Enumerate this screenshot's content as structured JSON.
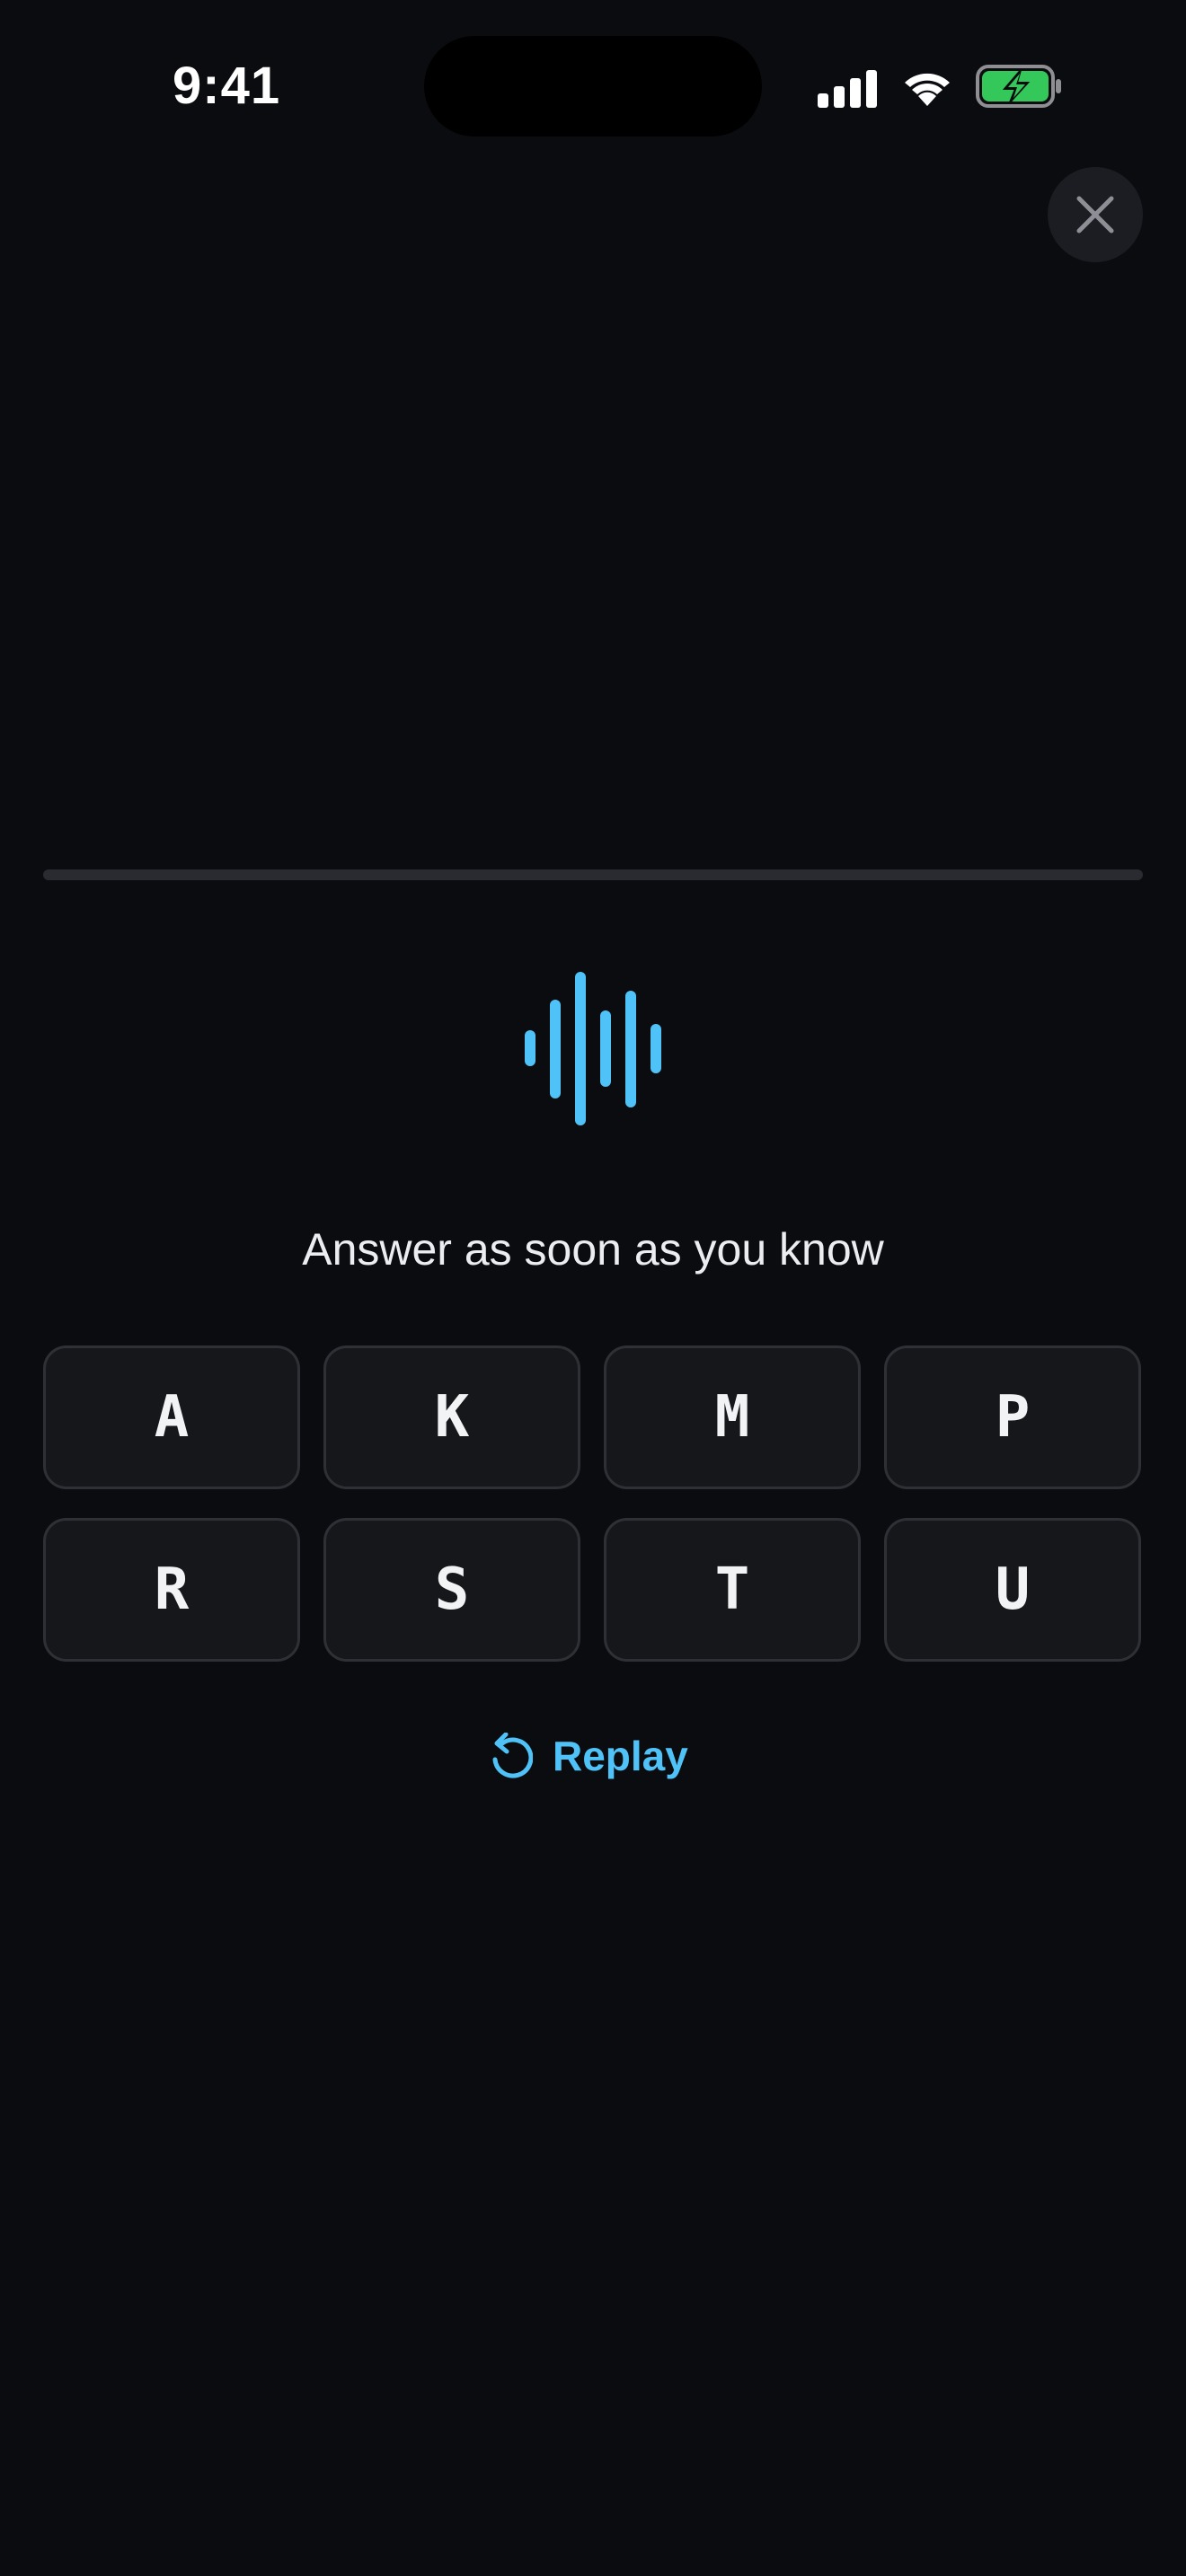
{
  "status_bar": {
    "time": "9:41",
    "icons": [
      "cellular-signal-icon",
      "wifi-icon",
      "battery-charging-icon"
    ],
    "battery_color": "#34c759"
  },
  "header": {
    "close_icon": "close-icon"
  },
  "progress": {
    "fraction": 0.0
  },
  "audio": {
    "icon": "waveform-icon"
  },
  "prompt": {
    "text": "Answer as soon as you know"
  },
  "keys": [
    "A",
    "K",
    "M",
    "P",
    "R",
    "S",
    "T",
    "U"
  ],
  "replay": {
    "label": "Replay",
    "icon": "replay-icon"
  },
  "colors": {
    "accent": "#4fc3f7",
    "background": "#0b0c10",
    "key_background": "#16171b",
    "key_border": "#2f3036"
  }
}
